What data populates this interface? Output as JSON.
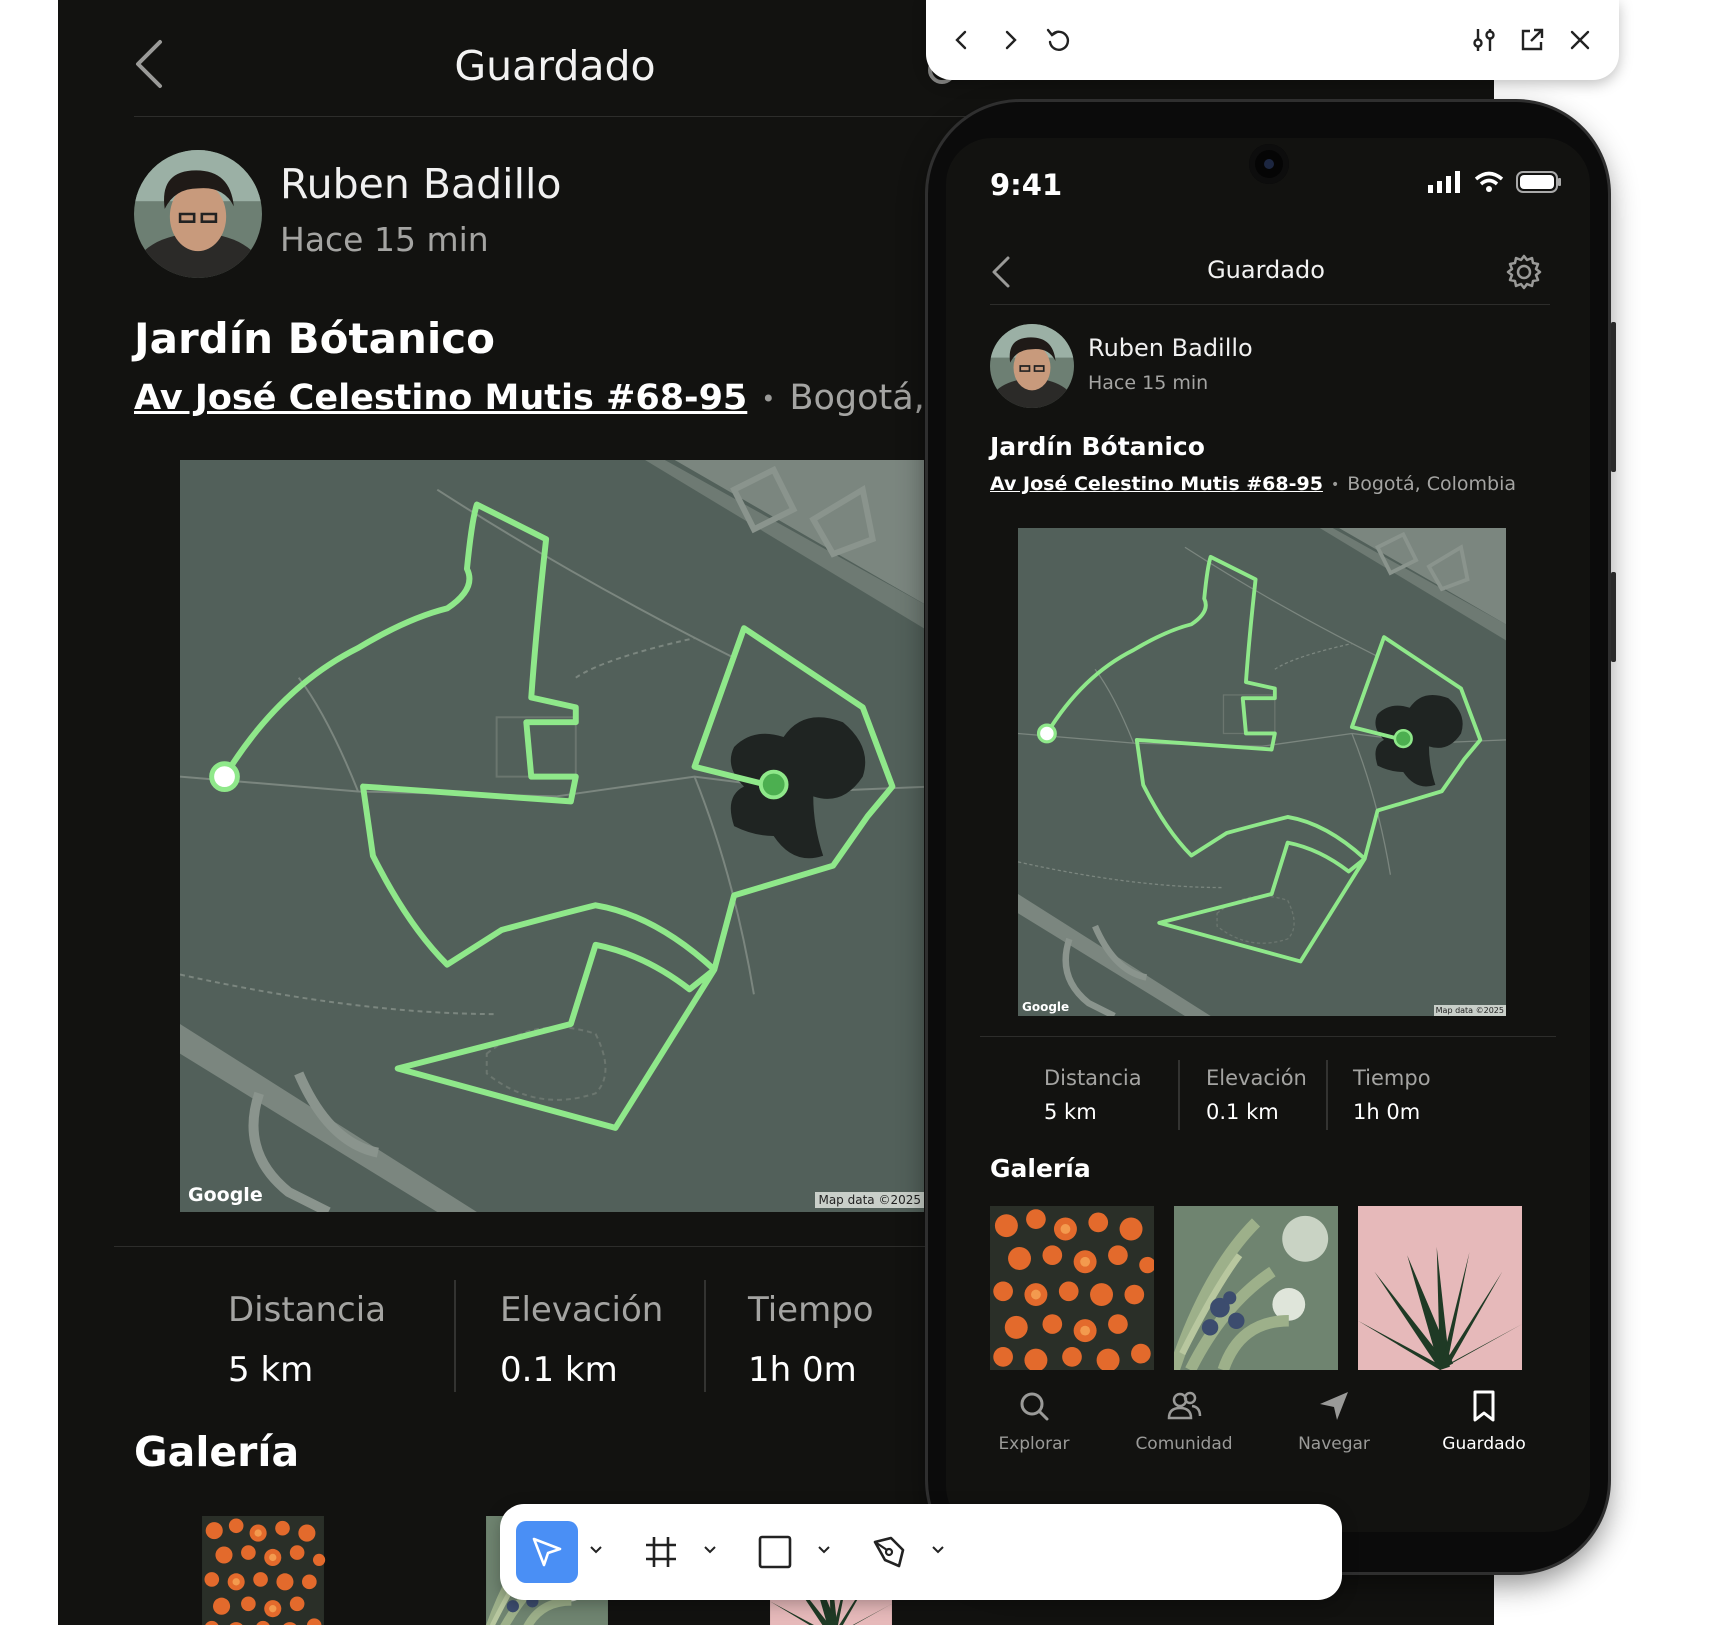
{
  "preview_bar": {
    "buttons": [
      "back",
      "forward",
      "reload",
      "settings-sliders",
      "open-external",
      "close"
    ]
  },
  "screen": {
    "status_time": "9:41",
    "header_title": "Guardado",
    "user_name": "Ruben Badillo",
    "post_time": "Hace 15 min",
    "place_name": "Jardín Bótanico",
    "address": "Av José Celestino Mutis #68-95",
    "city": "Bogotá, Colombia",
    "map": {
      "google_label": "Google",
      "map_data_label": "Map data ©2025",
      "colors": {
        "ground": "#52605a",
        "route": "#8fe88a",
        "start": "#ffffff",
        "end": "#4caf50",
        "roads": "#7b867f",
        "water": "#1f2422"
      }
    },
    "stats": [
      {
        "label": "Distancia",
        "value": "5 km"
      },
      {
        "label": "Elevación",
        "value": "0.1 km"
      },
      {
        "label": "Tiempo",
        "value": "1h 0m"
      }
    ],
    "gallery_title": "Galería",
    "gallery": [
      "orange-flowers-photo",
      "juniper-berries-photo",
      "palm-leaves-pink-photo"
    ],
    "tabs": [
      {
        "label": "Explorar",
        "icon": "search-icon",
        "active": false
      },
      {
        "label": "Comunidad",
        "icon": "people-icon",
        "active": false
      },
      {
        "label": "Navegar",
        "icon": "navigation-arrow-icon",
        "active": false
      },
      {
        "label": "Guardado",
        "icon": "bookmark-icon",
        "active": true
      }
    ]
  },
  "background": {
    "header_title": "Guardado",
    "user_name": "Ruben Badillo",
    "post_time": "Hace 15 min",
    "place_name": "Jardín Bótanico",
    "address": "Av José Celestino Mutis #68-95",
    "city": "Bogotá, Colombia",
    "google_label": "Google",
    "map_data_label": "Map data ©2025",
    "stats": [
      {
        "label": "Distancia",
        "value": "5 km"
      },
      {
        "label": "Elevación",
        "value": "0.1 km"
      },
      {
        "label": "Tiempo",
        "value": "1h 0m"
      }
    ],
    "gallery_title": "Galería"
  },
  "tool_bar": {
    "tools": [
      "move-tool",
      "frame-tool",
      "rectangle-tool",
      "pen-tool"
    ],
    "active_tool": "move-tool",
    "accent": "#4a8ff5"
  },
  "colors": {
    "app_bg": "#121210",
    "text_primary": "#ffffff",
    "text_secondary": "#a4a4a2",
    "divider": "#2d2d2b"
  }
}
